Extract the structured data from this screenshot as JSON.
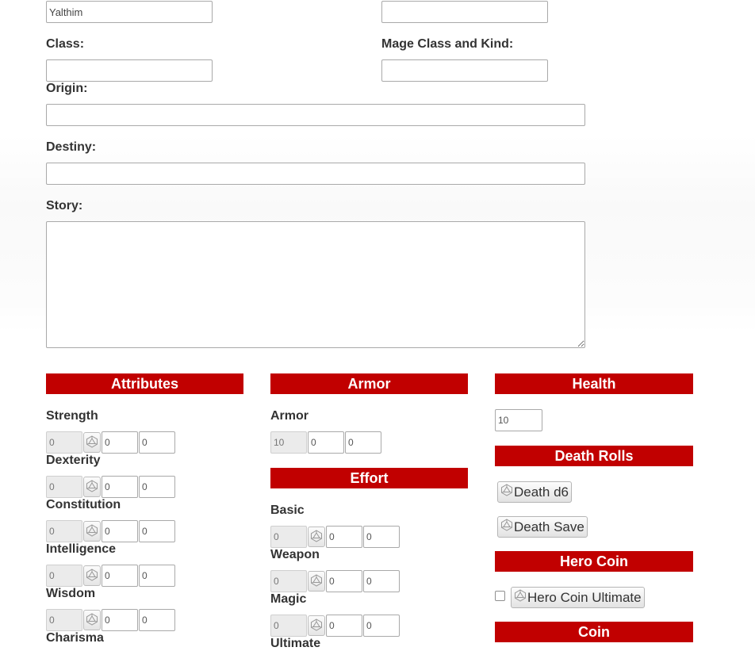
{
  "top_fields": {
    "name_value": "Yalthim",
    "right_top_value": "",
    "class_label": "Class:",
    "class_value": "",
    "mage_class_label": "Mage Class and Kind:",
    "mage_class_value": "",
    "origin_label": "Origin:",
    "origin_value": "",
    "destiny_label": "Destiny:",
    "destiny_value": "",
    "story_label": "Story:",
    "story_value": ""
  },
  "attributes": {
    "header": "Attributes",
    "items": [
      {
        "label": "Strength",
        "base": "0",
        "mod": "0",
        "bonus": "0"
      },
      {
        "label": "Dexterity",
        "base": "0",
        "mod": "0",
        "bonus": "0"
      },
      {
        "label": "Constitution",
        "base": "0",
        "mod": "0",
        "bonus": "0"
      },
      {
        "label": "Intelligence",
        "base": "0",
        "mod": "0",
        "bonus": "0"
      },
      {
        "label": "Wisdom",
        "base": "0",
        "mod": "0",
        "bonus": "0"
      },
      {
        "label": "Charisma"
      }
    ]
  },
  "armor": {
    "header": "Armor",
    "label": "Armor",
    "base": "10",
    "mod": "0",
    "bonus": "0"
  },
  "effort": {
    "header": "Effort",
    "items": [
      {
        "label": "Basic",
        "base": "0",
        "mod": "0",
        "bonus": "0"
      },
      {
        "label": "Weapon",
        "base": "0",
        "mod": "0",
        "bonus": "0"
      },
      {
        "label": "Magic",
        "base": "0",
        "mod": "0",
        "bonus": "0"
      },
      {
        "label": "Ultimate"
      }
    ]
  },
  "health": {
    "header": "Health",
    "value": "10"
  },
  "death_rolls": {
    "header": "Death Rolls",
    "death_d6_label": "Death d6",
    "death_save_label": "Death Save"
  },
  "hero_coin": {
    "header": "Hero Coin",
    "checked": false,
    "button_label": "Hero Coin Ultimate"
  },
  "coin": {
    "header": "Coin"
  },
  "icons": {
    "dice": "d20-dice-icon"
  },
  "colors": {
    "section_header_bg": "#c10000",
    "section_header_text": "#ffffff"
  }
}
